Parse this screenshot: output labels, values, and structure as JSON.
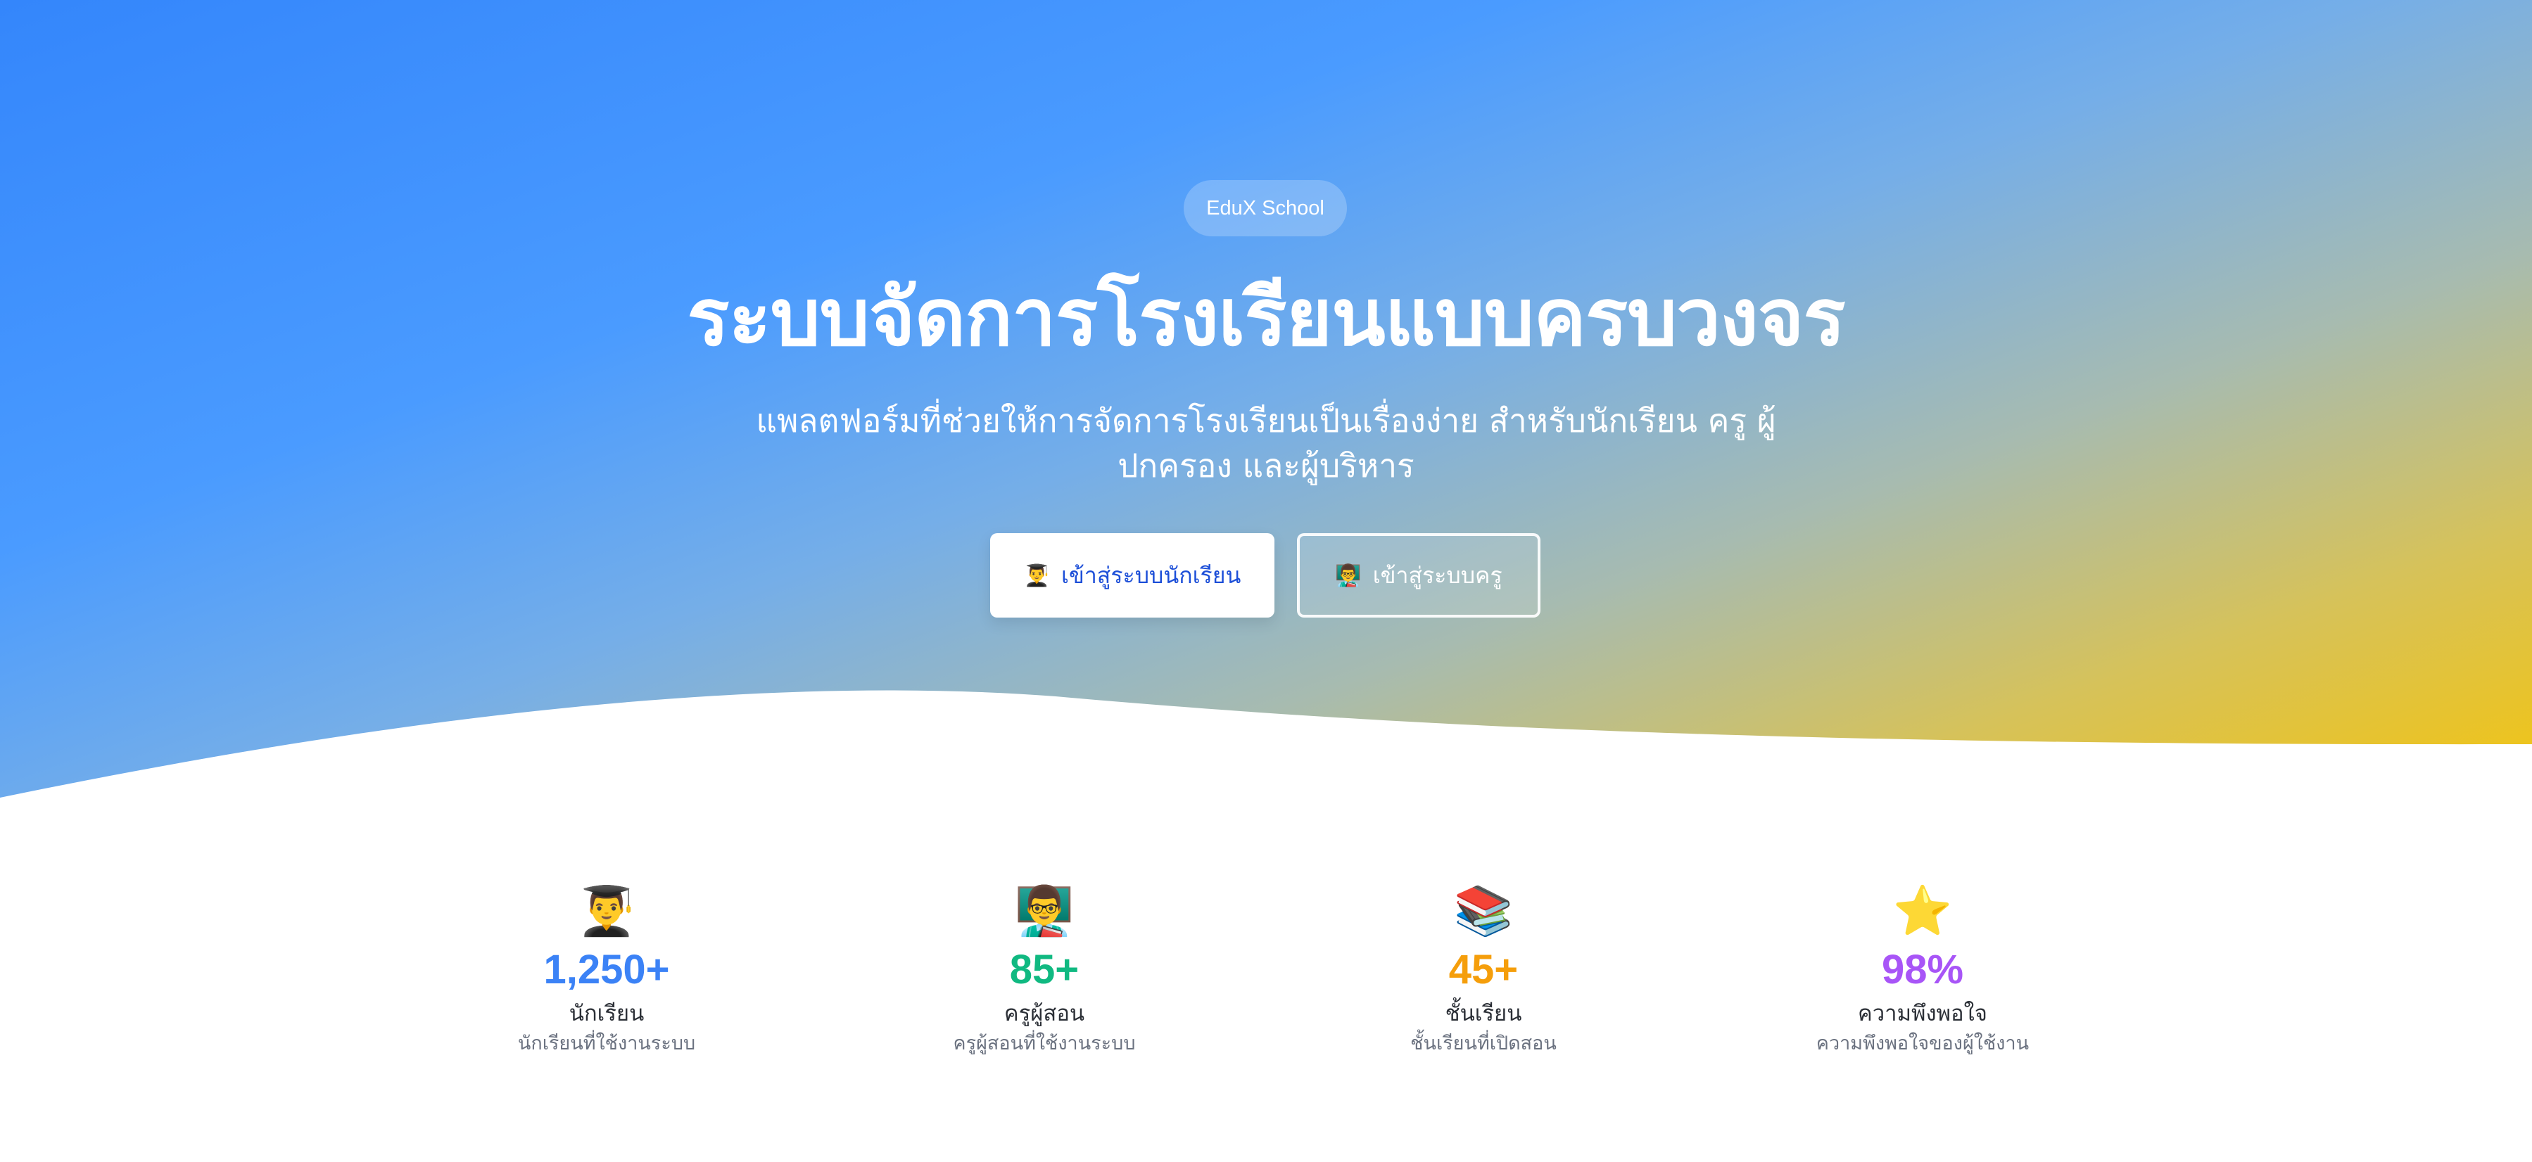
{
  "hero": {
    "badge": "EduX School",
    "title": "ระบบจัดการโรงเรียนแบบครบวงจร",
    "subtitle": "แพลตฟอร์มที่ช่วยให้การจัดการโรงเรียนเป็นเรื่องง่าย สำหรับนักเรียน ครู ผู้ปกครอง และผู้บริหาร",
    "buttons": [
      {
        "icon": "👨‍🎓",
        "icon_name": "student-icon",
        "label": "เข้าสู่ระบบนักเรียน"
      },
      {
        "icon": "👨‍🏫",
        "icon_name": "teacher-icon",
        "label": "เข้าสู่ระบบครู"
      }
    ]
  },
  "stats": [
    {
      "icon": "👨‍🎓",
      "icon_name": "student-icon",
      "value": "1,250+",
      "label": "นักเรียน",
      "desc": "นักเรียนที่ใช้งานระบบ",
      "color": "#3b82f6"
    },
    {
      "icon": "👨‍🏫",
      "icon_name": "teacher-icon",
      "value": "85+",
      "label": "ครูผู้สอน",
      "desc": "ครูผู้สอนที่ใช้งานระบบ",
      "color": "#10b981"
    },
    {
      "icon": "📚",
      "icon_name": "books-icon",
      "value": "45+",
      "label": "ชั้นเรียน",
      "desc": "ชั้นเรียนที่เปิดสอน",
      "color": "#f59e0b"
    },
    {
      "icon": "⭐",
      "icon_name": "star-icon",
      "value": "98%",
      "label": "ความพึงพอใจ",
      "desc": "ความพึงพอใจของผู้ใช้งาน",
      "color": "#a855f7"
    }
  ]
}
